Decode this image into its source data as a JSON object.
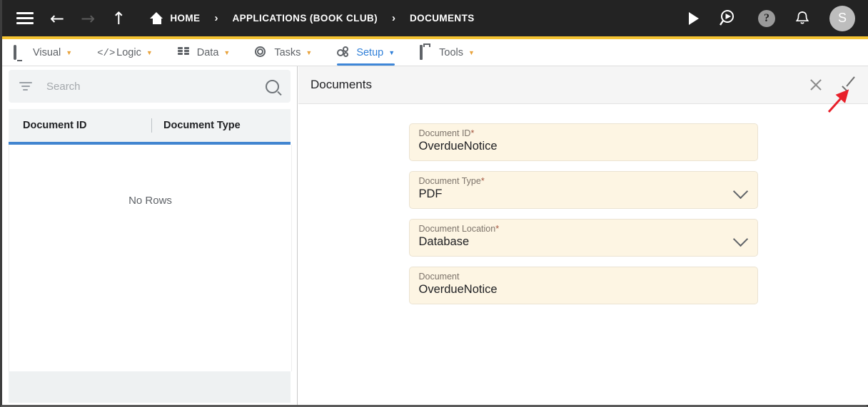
{
  "header": {
    "menu_icon": "hamburger-icon",
    "back_icon": "back-arrow-icon",
    "forward_icon": "forward-arrow-icon",
    "up_icon": "up-arrow-icon",
    "home_label": "HOME",
    "separator": "›",
    "breadcrumbs": [
      {
        "label": "APPLICATIONS (BOOK CLUB)"
      },
      {
        "label": "DOCUMENTS"
      }
    ],
    "actions": {
      "run_icon": "play-icon",
      "search_play_icon": "search-play-icon",
      "help_icon": "help-circle-icon",
      "help_glyph": "?",
      "notifications_icon": "bell-icon",
      "avatar_initial": "S"
    },
    "accent_color": "#f5c433",
    "background_color": "#232323"
  },
  "menubar": {
    "caret": "▼",
    "items": [
      {
        "label": "Visual",
        "icon": "monitor-icon",
        "active": false
      },
      {
        "label": "Logic",
        "icon": "code-icon",
        "active": false
      },
      {
        "label": "Data",
        "icon": "database-icon",
        "active": false
      },
      {
        "label": "Tasks",
        "icon": "target-icon",
        "active": false
      },
      {
        "label": "Setup",
        "icon": "gears-icon",
        "active": true
      },
      {
        "label": "Tools",
        "icon": "toolbox-icon",
        "active": false
      }
    ],
    "active_color": "#2f7fd8"
  },
  "left_panel": {
    "search": {
      "placeholder": "Search",
      "value": "",
      "filter_icon": "filter-icon",
      "search_icon": "search-icon"
    },
    "add_button": {
      "label": "+",
      "color": "#f7bf35"
    },
    "grid": {
      "columns": [
        "Document ID",
        "Document Type"
      ],
      "rows": [],
      "empty_message": "No Rows",
      "accent_color": "#4285d0"
    }
  },
  "right_panel": {
    "title": "Documents",
    "close_icon": "close-icon",
    "confirm_icon": "check-icon",
    "fields": [
      {
        "label": "Document ID",
        "required": true,
        "value": "OverdueNotice",
        "type": "text"
      },
      {
        "label": "Document Type",
        "required": true,
        "value": "PDF",
        "type": "select"
      },
      {
        "label": "Document Location",
        "required": true,
        "value": "Database",
        "type": "select"
      },
      {
        "label": "Document",
        "required": false,
        "value": "OverdueNotice",
        "type": "text"
      }
    ],
    "required_marker": "*"
  },
  "annotation": {
    "type": "arrow",
    "color": "#e8202a",
    "points_to": "check-icon"
  }
}
